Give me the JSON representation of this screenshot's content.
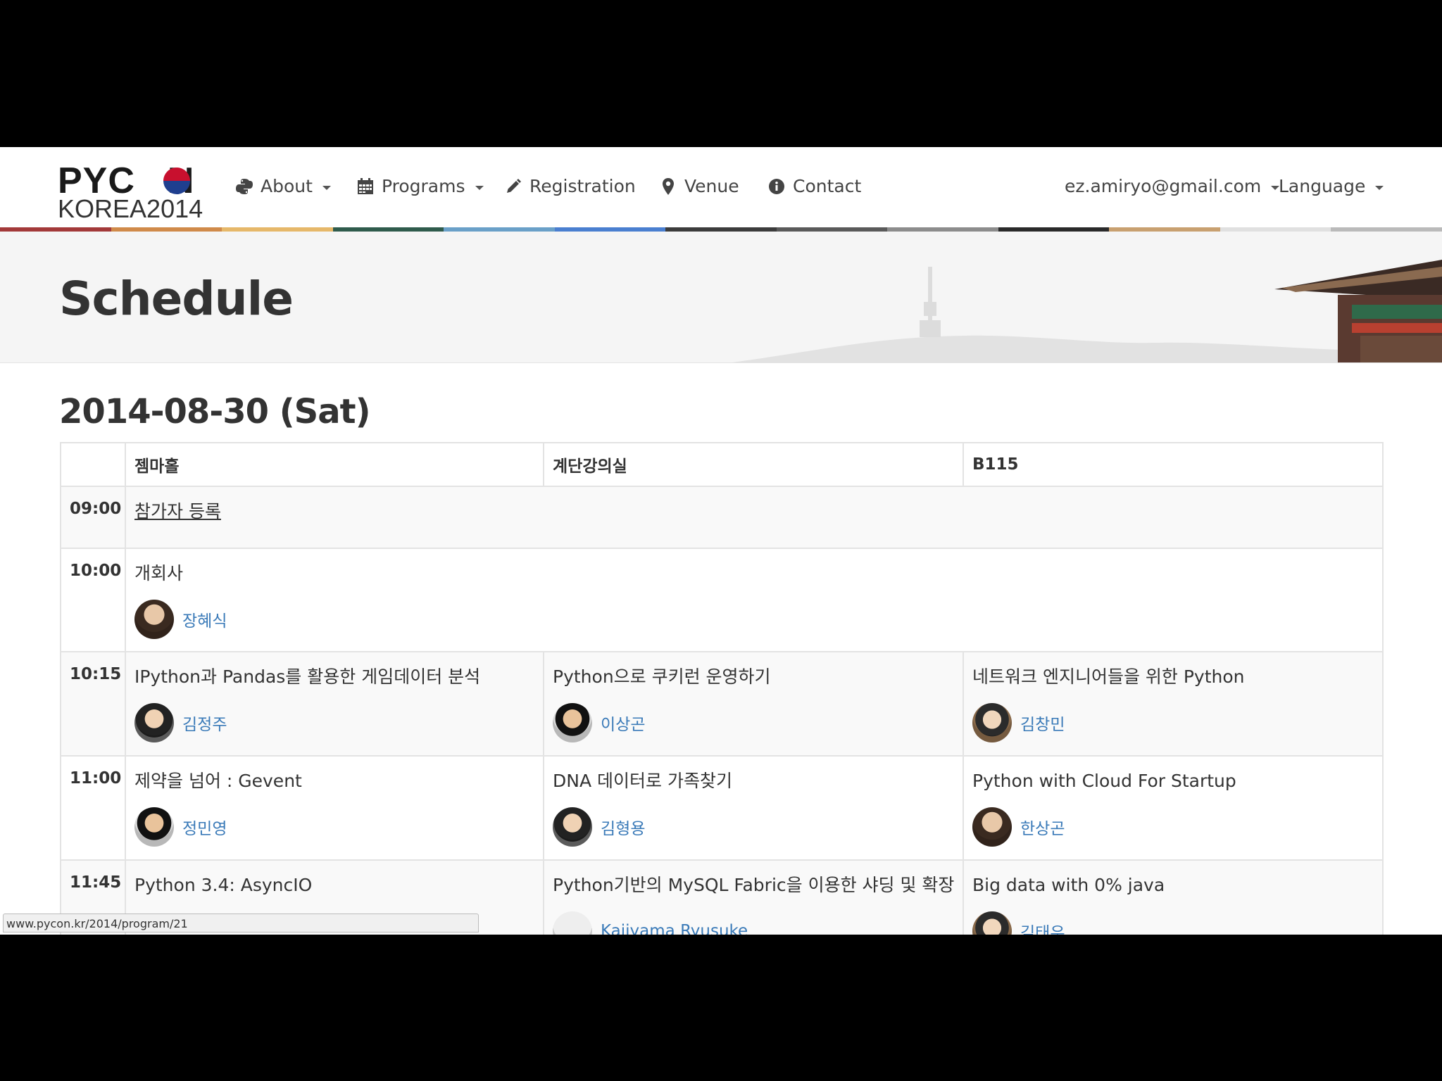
{
  "logo": {
    "line1": "PYC",
    "line1_tail": "N",
    "line2": "KOREA",
    "year": "2014"
  },
  "nav": {
    "items": [
      {
        "label": "About",
        "icon": "python-icon",
        "dropdown": true
      },
      {
        "label": "Programs",
        "icon": "calendar-icon",
        "dropdown": true
      },
      {
        "label": "Registration",
        "icon": "pencil-icon",
        "dropdown": false
      },
      {
        "label": "Venue",
        "icon": "map-marker-icon",
        "dropdown": false
      },
      {
        "label": "Contact",
        "icon": "info-icon",
        "dropdown": false
      }
    ],
    "user": "ez.amiryo@gmail.com",
    "language": "Language"
  },
  "stripe_colors": [
    "#a33a3a",
    "#d08a4a",
    "#e6b86a",
    "#2f5b4c",
    "#6aa0c8",
    "#4a7fd0",
    "#3c3c3c",
    "#5a5a5a",
    "#8c8c8c",
    "#2a2a2a",
    "#c8a070",
    "#e0e0e0",
    "#bababa"
  ],
  "page": {
    "title": "Schedule"
  },
  "schedule": {
    "date": "2014-08-30 (Sat)",
    "rooms": [
      "젬마홀",
      "계단강의실",
      "B115"
    ],
    "slots": [
      {
        "time": "09:00",
        "title": "참가자 등록"
      },
      {
        "time": "10:00",
        "title": "개회사",
        "speaker": "장혜식"
      },
      {
        "time": "10:15",
        "talks": [
          {
            "title": "IPython과 Pandas를 활용한 게임데이터 분석",
            "speaker": "김정주"
          },
          {
            "title": "Python으로 쿠키런 운영하기",
            "speaker": "이상곤"
          },
          {
            "title": "네트워크 엔지니어들을 위한 Python",
            "speaker": "김창민"
          }
        ]
      },
      {
        "time": "11:00",
        "talks": [
          {
            "title": "제약을 넘어 : Gevent",
            "speaker": "정민영"
          },
          {
            "title": "DNA 데이터로 가족찾기",
            "speaker": "김형용"
          },
          {
            "title": "Python with Cloud For Startup",
            "speaker": "한상곤"
          }
        ]
      },
      {
        "time": "11:45",
        "talks": [
          {
            "title": "Python 3.4: AsyncIO",
            "speaker": ""
          },
          {
            "title": "Python기반의 MySQL Fabric을 이용한 샤딩 및 확장",
            "speaker": "Kajiyama Ryusuke"
          },
          {
            "title": "Big data with 0% java",
            "speaker": "김태우"
          }
        ]
      }
    ]
  },
  "statusbar": {
    "url": "www.pycon.kr/2014/program/21"
  }
}
